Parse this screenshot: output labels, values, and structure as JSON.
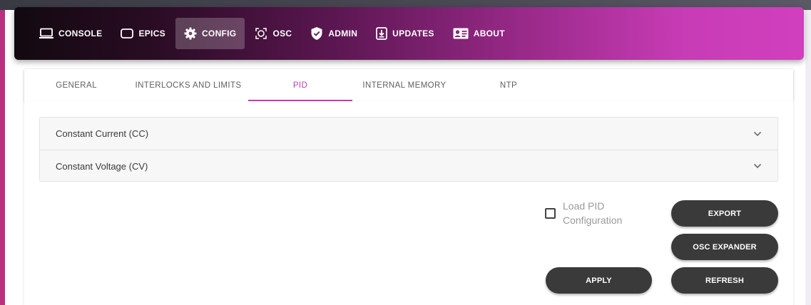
{
  "navbar": {
    "items": [
      {
        "label": "CONSOLE",
        "icon": "monitor-icon"
      },
      {
        "label": "EPICS",
        "icon": "rounded-square-icon"
      },
      {
        "label": "CONFIG",
        "icon": "gear-icon",
        "active": true
      },
      {
        "label": "OSC",
        "icon": "scan-frame-icon"
      },
      {
        "label": "ADMIN",
        "icon": "shield-check-icon"
      },
      {
        "label": "UPDATES",
        "icon": "download-box-icon"
      },
      {
        "label": "ABOUT",
        "icon": "id-card-icon"
      }
    ]
  },
  "tabs": [
    {
      "label": "GENERAL"
    },
    {
      "label": "INTERLOCKS AND LIMITS"
    },
    {
      "label": "PID",
      "active": true
    },
    {
      "label": "INTERNAL MEMORY"
    },
    {
      "label": "NTP"
    }
  ],
  "accordion": [
    {
      "label": "Constant Current (CC)"
    },
    {
      "label": "Constant Voltage (CV)"
    }
  ],
  "load_pid": {
    "label": "Load PID Configuration",
    "checked": false
  },
  "buttons": {
    "export": "EXPORT",
    "osc_expander": "OSC EXPANDER",
    "apply": "APPLY",
    "refresh": "REFRESH"
  },
  "colors": {
    "accent": "#c23db0",
    "button_bg": "#3a3a3a"
  }
}
